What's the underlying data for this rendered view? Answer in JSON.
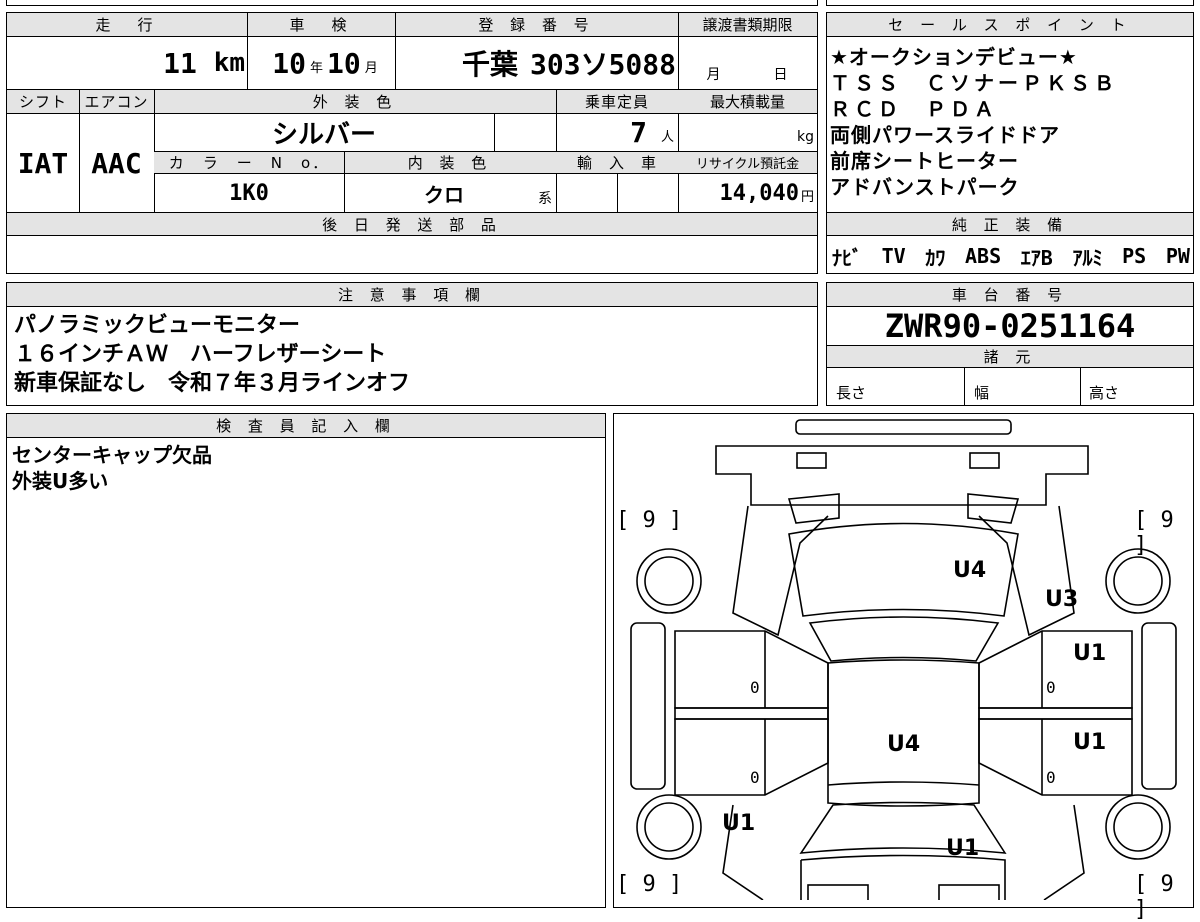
{
  "vehicle": {
    "headers": {
      "mileage": "走　行",
      "inspection": "車　検",
      "registration": "登 録 番 号",
      "transfer_deadline": "譲渡書類期限",
      "shift": "シフト",
      "aircon": "エアコン",
      "exterior_color": "外 装 色",
      "capacity": "乗車定員",
      "max_load": "最大積載量",
      "color_no": "カ　ラ　ー　N　o．",
      "interior_color": "内 装 色",
      "import": "輸　入　車",
      "recycle": "リサイクル預託金",
      "later_parts": "後 日 発 送 部 品"
    },
    "mileage_value": "11",
    "mileage_unit": "km",
    "inspection_year": "10",
    "year_unit": "年",
    "inspection_month": "10",
    "month_unit": "月",
    "registration_region": "千葉",
    "registration_number": "303ソ5088",
    "deadline_month_unit": "月",
    "deadline_day_unit": "日",
    "shift_value": "IAT",
    "aircon_value": "AAC",
    "exterior_color_value": "シルバー",
    "capacity_value": "7",
    "capacity_unit": "人",
    "max_load_unit": "kg",
    "color_no_value": "1K0",
    "interior_color_value": "クロ",
    "interior_suffix": "系",
    "recycle_value": "14,040",
    "recycle_unit": "円"
  },
  "sales_points": {
    "header": "セ ー ル ス ポ イ ン ト",
    "lines": [
      "★オークションデビュー★",
      "ＴＳＳ　ＣソナーＰＫＳＢ",
      "ＲＣＤ　ＰＤＡ",
      "両側パワースライドドア",
      "前席シートヒーター",
      "アドバンストパーク"
    ]
  },
  "equipment": {
    "header": "純 正 装 備",
    "items": [
      "ﾅﾋﾞ",
      "TV",
      "ｶﾜ",
      "ABS",
      "ｴｱB",
      "ｱﾙﾐ",
      "PS",
      "PW"
    ]
  },
  "notes": {
    "header": "注 意 事 項 欄",
    "lines": [
      "パノラミックビューモニター",
      "１６インチＡＷ　ハーフレザーシート",
      "新車保証なし　令和７年３月ラインオフ"
    ]
  },
  "chassis": {
    "header": "車 台 番 号",
    "value": "ZWR90-0251164",
    "spec_header": "諸 元",
    "length_label": "長さ",
    "width_label": "幅",
    "height_label": "高さ"
  },
  "inspector": {
    "header": "検 査 員 記 入 欄",
    "lines": [
      "センターキャップ欠品",
      "外装U多い"
    ]
  },
  "diagram": {
    "bracket_tl": "[ 9 ]",
    "bracket_tr": "[ 9 ]",
    "bracket_bl": "[ 9 ]",
    "bracket_br": "[ 9 ]",
    "mark_hood": "U4",
    "mark_front_right": "U3",
    "mark_door_fr": "U1",
    "mark_door_rr": "U1",
    "mark_roof": "U4",
    "mark_rear_left": "U1",
    "mark_rear": "U1",
    "zero_fl": "0",
    "zero_fr": "0",
    "zero_rl": "0",
    "zero_rr": "0"
  }
}
